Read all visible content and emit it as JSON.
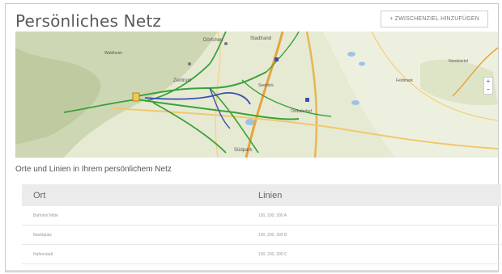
{
  "header": {
    "title": "Persönliches Netz",
    "add_button_label": "+ ZWISCHENZIEL HINZUFÜGEN"
  },
  "map": {
    "places": [
      "Dörfchen",
      "Stadtrand",
      "Zentrum",
      "Seeblick",
      "Feldmark",
      "Waldheim",
      "Nordviertel",
      "Ostbahnhof",
      "Südpark"
    ],
    "zoom_label": "+ −"
  },
  "section": {
    "subtitle": "Orte und Linien in Ihrem persönlichem Netz"
  },
  "table": {
    "headers": {
      "ort": "Ort",
      "linien": "Linien"
    },
    "rows": [
      {
        "ort": "Bahnhof Mitte",
        "linien": "100, 200, 300 A"
      },
      {
        "ort": "Marktplatz",
        "linien": "100, 200, 300 B"
      },
      {
        "ort": "Hafenstadt",
        "linien": "100, 200, 300 C"
      }
    ]
  },
  "colors": {
    "route_green": "#3aa13a",
    "route_blue": "#3b4fb0",
    "road_orange": "#e8a33b",
    "map_base": "#e8ecd6",
    "header_bg": "#ebebeb"
  }
}
